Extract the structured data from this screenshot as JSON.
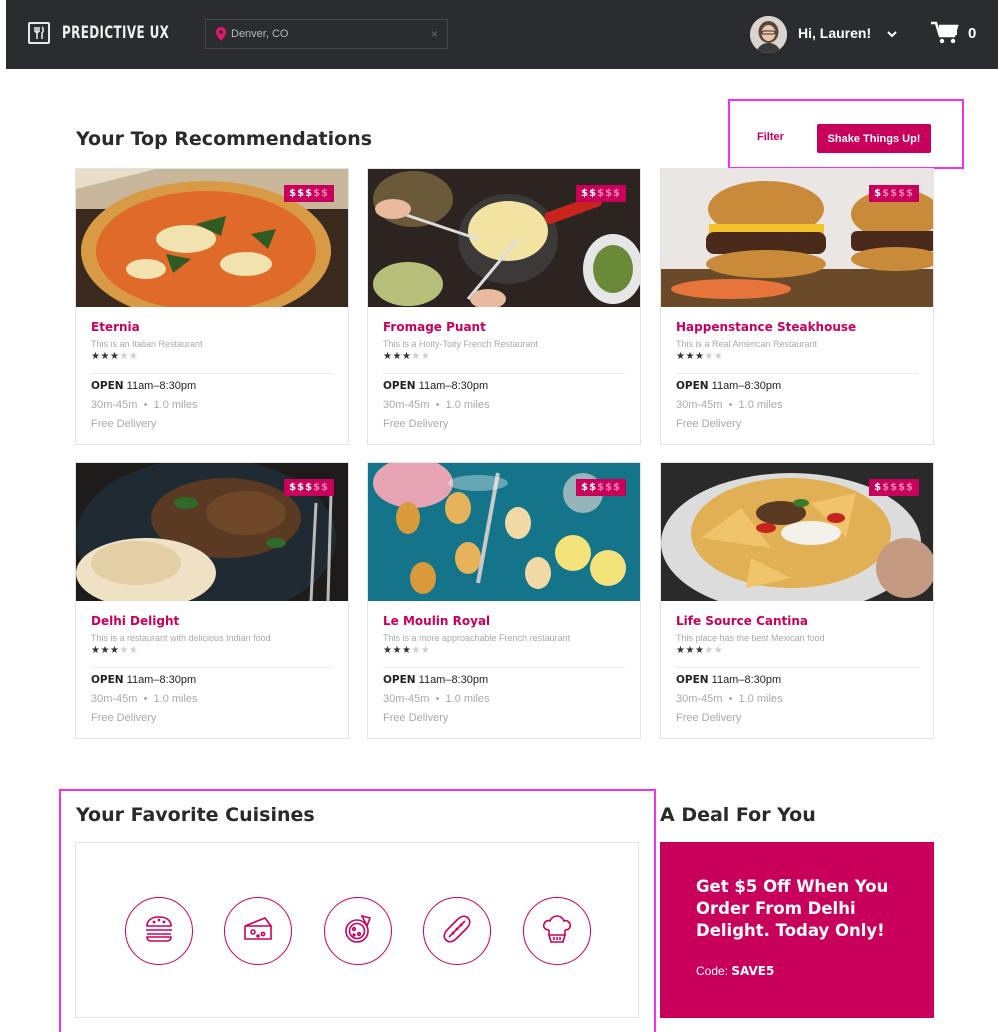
{
  "brand": {
    "name": "PREDICTIVE UX",
    "accent": "#c8005c",
    "nav_bg": "#2b2c30"
  },
  "location": {
    "value": "Denver, CO",
    "clear_glyph": "×",
    "icon": "map-pin-icon"
  },
  "user": {
    "greeting": "Hi, Lauren!",
    "chevron": "chevron-down-icon"
  },
  "cart": {
    "count": "0",
    "icon": "cart-icon"
  },
  "recommendations": {
    "title": "Your Top Recommendations",
    "filter_label": "Filter",
    "shake_label": "Shake Things Up!",
    "cards": [
      {
        "name": "Eternia",
        "desc": "This is an Italian Restaurant",
        "price": "$$$$$",
        "price_level": 3,
        "rating": 3,
        "rating_max": 5,
        "open_label": "OPEN",
        "hours": "11am–8:30pm",
        "eta": "30m-45m  •  1.0 miles",
        "delivery": "Free Delivery",
        "image": "pizza"
      },
      {
        "name": "Fromage Puant",
        "desc": "This is a Hoity-Toity French Restaurant",
        "price": "$$$$$",
        "price_level": 2,
        "rating": 3,
        "rating_max": 5,
        "open_label": "OPEN",
        "hours": "11am–8:30pm",
        "eta": "30m-45m  •  1.0 miles",
        "delivery": "Free Delivery",
        "image": "fondue"
      },
      {
        "name": "Happenstance Steakhouse",
        "desc": "This is a Real American Restaurant",
        "price": "$$$$$",
        "price_level": 1,
        "rating": 3,
        "rating_max": 5,
        "open_label": "OPEN",
        "hours": "11am–8:30pm",
        "eta": "30m-45m  •  1.0 miles",
        "delivery": "Free Delivery",
        "image": "burgers"
      },
      {
        "name": "Delhi Delight",
        "desc": "This is a restaurant with delicious Indian food",
        "price": "$$$$$",
        "price_level": 3,
        "rating": 3,
        "rating_max": 5,
        "open_label": "OPEN",
        "hours": "11am–8:30pm",
        "eta": "30m-45m  •  1.0 miles",
        "delivery": "Free Delivery",
        "image": "curry"
      },
      {
        "name": "Le Moulin Royal",
        "desc": "This is a more approachable French restaurant",
        "price": "$$$$$",
        "price_level": 2,
        "rating": 3,
        "rating_max": 5,
        "open_label": "OPEN",
        "hours": "11am–8:30pm",
        "eta": "30m-45m  •  1.0 miles",
        "delivery": "Free Delivery",
        "image": "madeleines"
      },
      {
        "name": "Life Source Cantina",
        "desc": "This place has the best Mexican food",
        "price": "$$$$$",
        "price_level": 1,
        "rating": 3,
        "rating_max": 5,
        "open_label": "OPEN",
        "hours": "11am–8:30pm",
        "eta": "30m-45m  •  1.0 miles",
        "delivery": "Free Delivery",
        "image": "nachos"
      }
    ]
  },
  "cuisines": {
    "title": "Your Favorite Cuisines",
    "items": [
      {
        "icon": "burger-icon"
      },
      {
        "icon": "cheese-icon"
      },
      {
        "icon": "pizza-icon"
      },
      {
        "icon": "hotdog-icon"
      },
      {
        "icon": "chef-hat-icon"
      }
    ]
  },
  "deal": {
    "title": "A Deal For You",
    "text": "Get $5 Off When You Order From Delhi Delight. Today Only!",
    "code_label": "Code:",
    "code": "SAVE5"
  }
}
